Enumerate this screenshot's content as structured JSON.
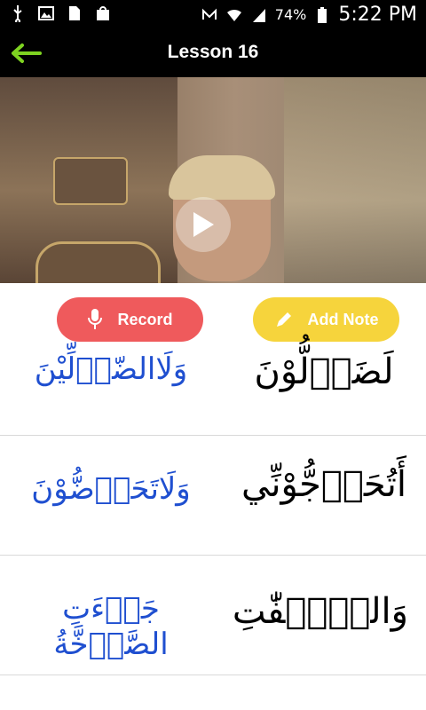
{
  "status_bar": {
    "battery": "74%",
    "time": "5:22 PM"
  },
  "header": {
    "title": "Lesson 16"
  },
  "actions": {
    "record_label": "Record",
    "add_note_label": "Add Note"
  },
  "rows": [
    {
      "left": "وَلَاالضّاۤلِّيْنَ",
      "right": "لَضَاۤلُّوْنَ"
    },
    {
      "left": "وَلَاتَحَاۤضُّوْنَ",
      "right": "أَتُحَاۤجُّوْنِّي"
    },
    {
      "left": "جَاۤءَتِ الصَّاۤخَّةُ",
      "right": "وَالصّٰۤفّٰتِ"
    },
    {
      "left": "",
      "right": ""
    }
  ],
  "colors": {
    "record": "#ef5a5c",
    "add_note": "#f6d43c",
    "back_arrow": "#7ed321",
    "arabic_blue": "#1f4fd0"
  },
  "icons": {
    "back": "arrow-left-icon",
    "play": "play-icon",
    "mic": "mic-icon",
    "pencil": "pencil-icon"
  }
}
